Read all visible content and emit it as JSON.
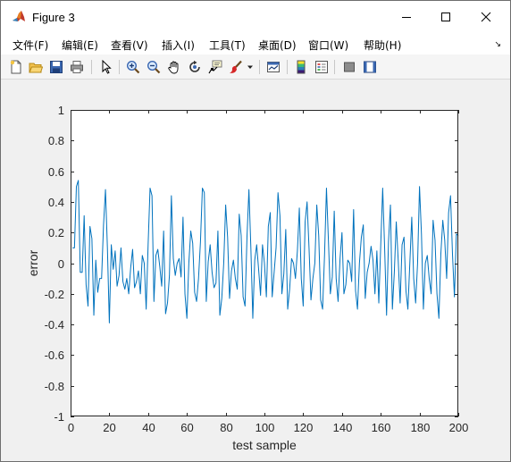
{
  "window": {
    "title": "Figure 3",
    "controls": {
      "minimize_icon": "minimize-icon",
      "maximize_icon": "maximize-icon",
      "close_icon": "close-icon"
    }
  },
  "menubar": {
    "items": [
      {
        "label": "文件(F)"
      },
      {
        "label": "编辑(E)"
      },
      {
        "label": "查看(V)"
      },
      {
        "label": "插入(I)"
      },
      {
        "label": "工具(T)"
      },
      {
        "label": "桌面(D)"
      },
      {
        "label": "窗口(W)"
      },
      {
        "label": "帮助(H)"
      }
    ],
    "corner_symbol": "↘"
  },
  "toolbar": {
    "buttons": [
      {
        "name": "new-figure",
        "icon": "new-file-icon"
      },
      {
        "name": "open-file",
        "icon": "folder-open-icon"
      },
      {
        "name": "save-figure",
        "icon": "save-icon"
      },
      {
        "name": "print-figure",
        "icon": "print-icon"
      },
      {
        "name": "edit-plot",
        "icon": "pointer-arrow-icon"
      },
      {
        "name": "zoom-in",
        "icon": "zoom-in-icon"
      },
      {
        "name": "zoom-out",
        "icon": "zoom-out-icon"
      },
      {
        "name": "pan",
        "icon": "hand-icon"
      },
      {
        "name": "rotate-3d",
        "icon": "rotate-icon"
      },
      {
        "name": "data-cursor",
        "icon": "data-cursor-icon"
      },
      {
        "name": "brush",
        "icon": "brush-icon"
      },
      {
        "name": "link-plot",
        "icon": "link-plot-icon"
      },
      {
        "name": "insert-colorbar",
        "icon": "colorbar-icon"
      },
      {
        "name": "insert-legend",
        "icon": "legend-icon"
      },
      {
        "name": "hide-plot-tools",
        "icon": "hide-tools-icon"
      },
      {
        "name": "show-plot-tools",
        "icon": "show-tools-icon"
      }
    ]
  },
  "colors": {
    "line": "#0072BD",
    "axes_bg": "#ffffff",
    "figure_bg": "#f0f0f0",
    "axis": "#262626"
  },
  "chart_data": {
    "type": "line",
    "title": "",
    "xlabel": "test sample",
    "ylabel": "error",
    "xlim": [
      0,
      200
    ],
    "ylim": [
      -1,
      1
    ],
    "xticks": [
      0,
      20,
      40,
      60,
      80,
      100,
      120,
      140,
      160,
      180,
      200
    ],
    "yticks": [
      -1,
      -0.8,
      -0.6,
      -0.4,
      -0.2,
      0,
      0.2,
      0.4,
      0.6,
      0.8,
      1
    ],
    "ytick_labels": [
      "-1",
      "-0.8",
      "-0.6",
      "-0.4",
      "-0.2",
      "0",
      "0.2",
      "0.4",
      "0.6",
      "0.8",
      "1"
    ],
    "grid": false,
    "series": [
      {
        "x": [
          1,
          2,
          3,
          4,
          5,
          6,
          7,
          8,
          9,
          10,
          11,
          12,
          13,
          14,
          15,
          16,
          17,
          18,
          19,
          20,
          21,
          22,
          23,
          24,
          25,
          26,
          27,
          28,
          29,
          30,
          31,
          32,
          33,
          34,
          35,
          36,
          37,
          38,
          39,
          40,
          41,
          42,
          43,
          44,
          45,
          46,
          47,
          48,
          49,
          50,
          51,
          52,
          53,
          54,
          55,
          56,
          57,
          58,
          59,
          60,
          61,
          62,
          63,
          64,
          65,
          66,
          67,
          68,
          69,
          70,
          71,
          72,
          73,
          74,
          75,
          76,
          77,
          78,
          79,
          80,
          81,
          82,
          83,
          84,
          85,
          86,
          87,
          88,
          89,
          90,
          91,
          92,
          93,
          94,
          95,
          96,
          97,
          98,
          99,
          100,
          101,
          102,
          103,
          104,
          105,
          106,
          107,
          108,
          109,
          110,
          111,
          112,
          113,
          114,
          115,
          116,
          117,
          118,
          119,
          120,
          121,
          122,
          123,
          124,
          125,
          126,
          127,
          128,
          129,
          130,
          131,
          132,
          133,
          134,
          135,
          136,
          137,
          138,
          139,
          140,
          141,
          142,
          143,
          144,
          145,
          146,
          147,
          148,
          149,
          150,
          151,
          152,
          153,
          154,
          155,
          156,
          157,
          158,
          159,
          160,
          161,
          162,
          163,
          164,
          165,
          166,
          167,
          168,
          169,
          170,
          171,
          172,
          173,
          174,
          175,
          176,
          177,
          178,
          179,
          180,
          181,
          182,
          183,
          184,
          185,
          186,
          187,
          188,
          189,
          190,
          191,
          192,
          193,
          194,
          195,
          196,
          197,
          198,
          199,
          200
        ],
        "y": [
          0.1,
          0.1,
          0.5,
          0.54,
          -0.06,
          -0.06,
          0.31,
          -0.14,
          -0.28,
          0.24,
          0.16,
          -0.34,
          0.02,
          -0.19,
          -0.1,
          -0.1,
          0.25,
          0.48,
          0.1,
          -0.39,
          0.12,
          -0.04,
          0.08,
          -0.15,
          -0.08,
          0.1,
          -0.12,
          -0.17,
          -0.1,
          -0.2,
          -0.03,
          0.09,
          -0.16,
          -0.12,
          -0.05,
          -0.2,
          0.05,
          0.0,
          -0.3,
          0.12,
          0.49,
          0.44,
          -0.25,
          0.05,
          0.09,
          -0.02,
          -0.15,
          0.21,
          -0.33,
          -0.26,
          -0.08,
          0.44,
          0.03,
          -0.08,
          0.0,
          0.03,
          -0.09,
          0.3,
          -0.2,
          -0.36,
          0.0,
          0.21,
          0.13,
          -0.19,
          -0.25,
          -0.1,
          0.14,
          0.49,
          0.46,
          -0.25,
          0.01,
          0.12,
          -0.06,
          -0.16,
          -0.13,
          0.21,
          -0.34,
          -0.23,
          0.0,
          0.38,
          0.17,
          -0.23,
          -0.05,
          0.02,
          -0.1,
          -0.17,
          0.32,
          0.18,
          -0.22,
          -0.28,
          0.17,
          0.48,
          0.1,
          -0.36,
          0.02,
          0.12,
          -0.04,
          -0.21,
          0.12,
          0.0,
          -0.22,
          0.24,
          0.33,
          -0.22,
          -0.06,
          0.1,
          0.46,
          0.31,
          -0.2,
          -0.07,
          0.22,
          -0.3,
          -0.17,
          0.03,
          0.0,
          -0.1,
          0.08,
          0.36,
          -0.1,
          -0.28,
          0.27,
          0.4,
          0.1,
          -0.24,
          -0.1,
          0.0,
          0.38,
          0.18,
          -0.24,
          -0.3,
          0.05,
          0.49,
          0.15,
          -0.2,
          -0.09,
          0.34,
          -0.1,
          -0.25,
          0.03,
          0.2,
          -0.2,
          -0.14,
          0.02,
          0.0,
          -0.12,
          0.35,
          -0.18,
          -0.3,
          0.0,
          0.17,
          0.25,
          -0.23,
          -0.06,
          0.0,
          0.11,
          0.02,
          -0.2,
          0.08,
          -0.26,
          0.12,
          0.49,
          0.1,
          -0.34,
          0.14,
          0.38,
          -0.3,
          -0.06,
          0.27,
          0.02,
          -0.26,
          0.12,
          0.17,
          -0.18,
          -0.3,
          0.0,
          0.3,
          -0.1,
          -0.26,
          0.0,
          0.5,
          0.19,
          -0.3,
          0.0,
          0.05,
          -0.1,
          -0.2,
          0.28,
          0.15,
          -0.2,
          -0.36,
          0.06,
          0.28,
          0.15,
          -0.1,
          0.33,
          0.44,
          0.06,
          -0.22,
          0.19,
          0.18
        ]
      }
    ]
  }
}
